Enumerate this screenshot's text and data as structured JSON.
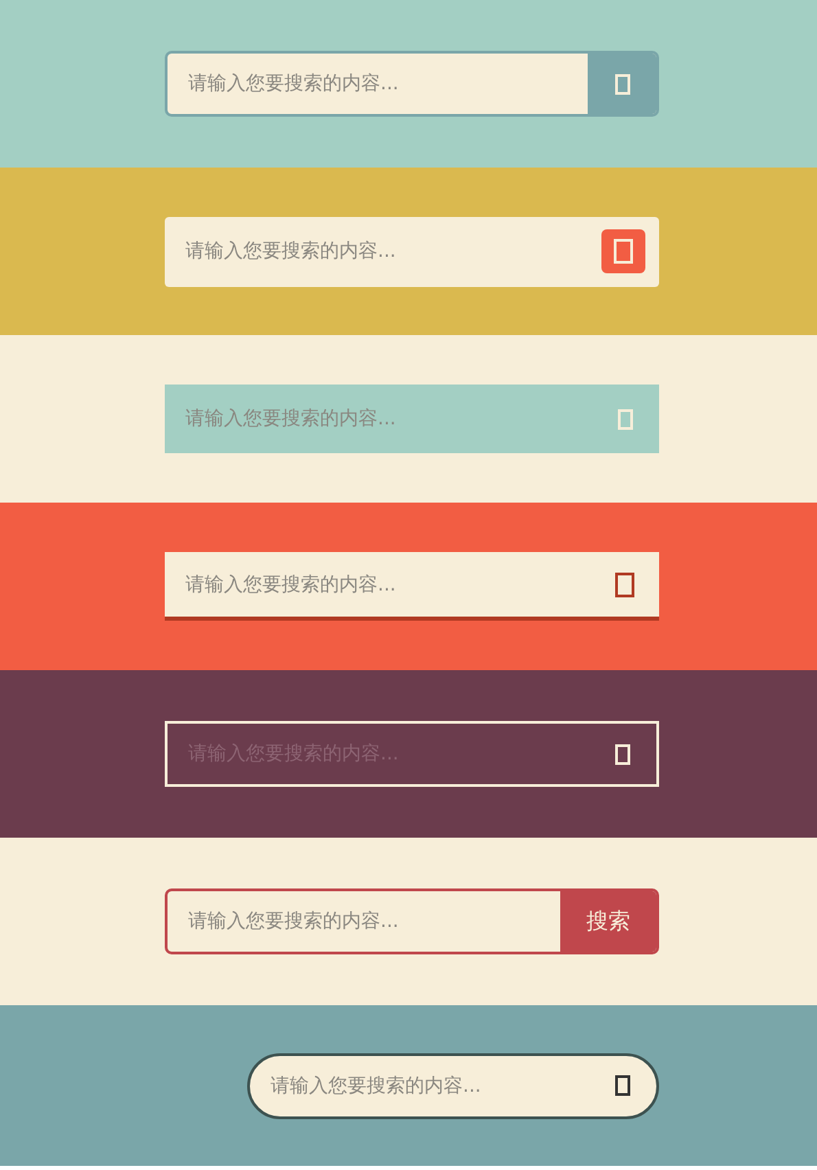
{
  "search_bars": [
    {
      "kind": "attached",
      "placeholder": "请输入您要搜索的内容..."
    },
    {
      "kind": "inset",
      "placeholder": "请输入您要搜索的内容..."
    },
    {
      "kind": "flat",
      "placeholder": "请输入您要搜索的内容..."
    },
    {
      "kind": "underline",
      "placeholder": "请输入您要搜索的内容..."
    },
    {
      "kind": "outline",
      "placeholder": "请输入您要搜索的内容..."
    },
    {
      "kind": "text-button",
      "placeholder": "请输入您要搜索的内容...",
      "button": "搜索"
    },
    {
      "kind": "pill",
      "placeholder": "请输入您要搜索的内容..."
    }
  ]
}
